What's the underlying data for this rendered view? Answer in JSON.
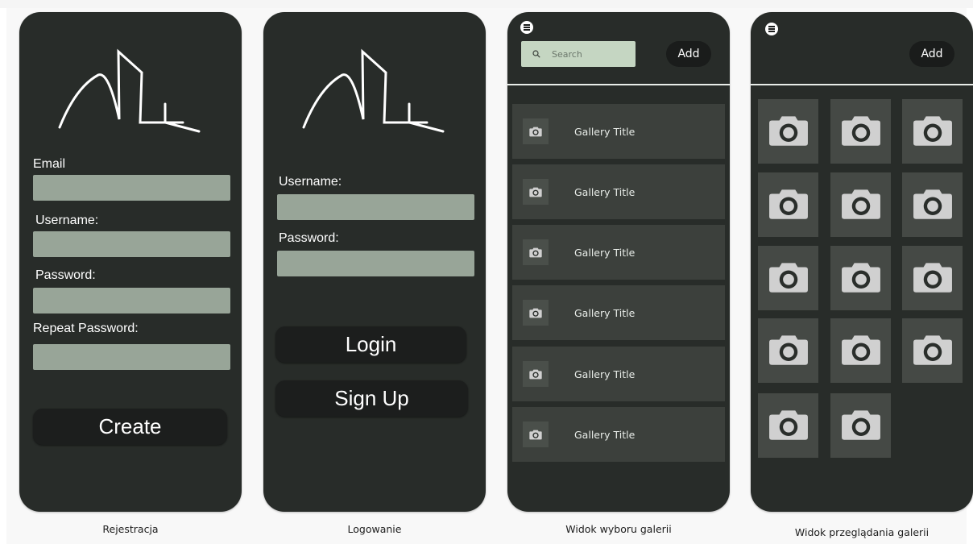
{
  "screens": {
    "register": {
      "caption": "Rejestracja",
      "fields": [
        "Email",
        "Username:",
        "Password:",
        "Repeat Password:"
      ],
      "create_label": "Create"
    },
    "login": {
      "caption": "Logowanie",
      "fields": [
        "Username:",
        "Password:"
      ],
      "login_label": "Login",
      "signup_label": "Sign Up"
    },
    "gallery_select": {
      "caption": "Widok wyboru galerii",
      "search_placeholder": "Search",
      "add_label": "Add",
      "items": [
        "Gallery Title",
        "Gallery Title",
        "Gallery Title",
        "Gallery Title",
        "Gallery Title",
        "Gallery Title"
      ]
    },
    "gallery_view": {
      "caption": "Widok przeglądania galerii",
      "add_label": "Add",
      "photo_count": 14
    }
  },
  "icons": {
    "logo": "app-logo",
    "menu": "menu-icon",
    "search": "search-icon",
    "thumbnail": "camera-icon"
  },
  "colors": {
    "phone_bg": "#282c29",
    "input_bg": "#98a598",
    "search_bg": "#c5d6c2",
    "button_bg": "#1c1e1d",
    "row_bg": "#3c403c",
    "tile_bg": "#454945",
    "camera_icon": "#d0d0d0"
  }
}
